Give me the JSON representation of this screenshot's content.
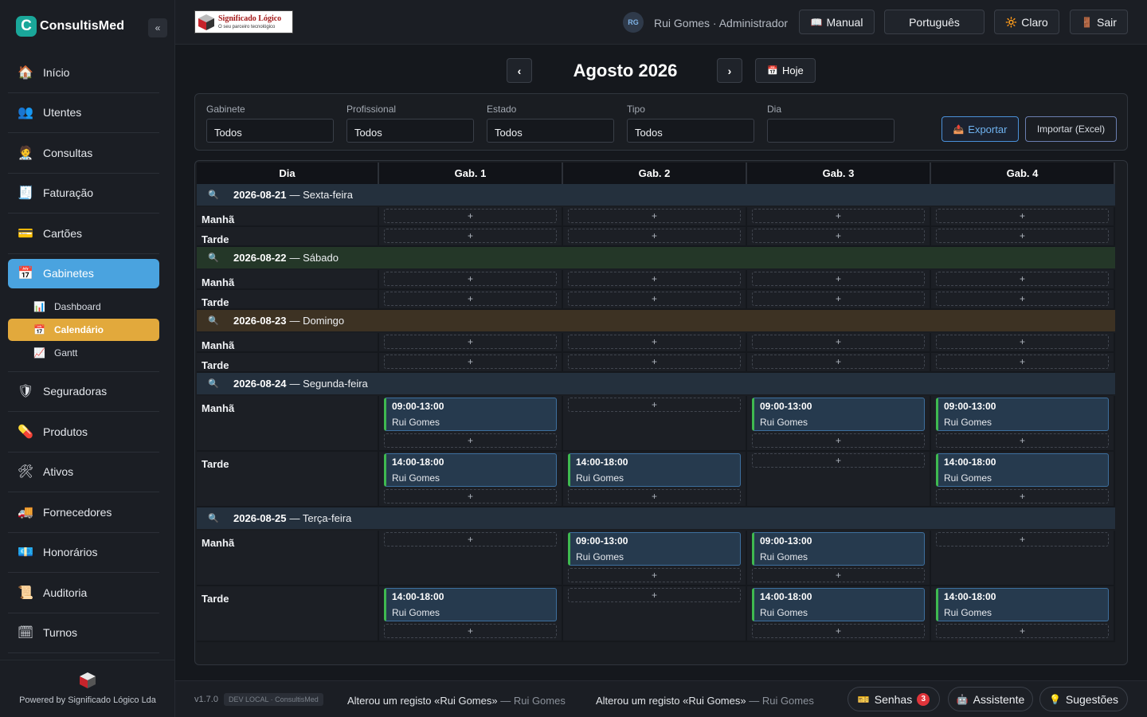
{
  "app": {
    "brand": "ConsultisMed",
    "brand_letter": "C",
    "collapse": "«",
    "powered_by": "Powered by Significado Lógico Lda"
  },
  "company_logo": {
    "title": "Significado Lógico",
    "tagline": "O seu parceiro tecnológico"
  },
  "sidebar": {
    "items": [
      {
        "label": "Início",
        "icon": "home-icon",
        "glyph": "🏠"
      },
      {
        "label": "Utentes",
        "icon": "users-icon",
        "glyph": "👥"
      },
      {
        "label": "Consultas",
        "icon": "doctor-icon",
        "glyph": "🧑‍⚕️"
      },
      {
        "label": "Faturação",
        "icon": "invoice-icon",
        "glyph": "🧾"
      },
      {
        "label": "Cartões",
        "icon": "card-icon",
        "glyph": "💳"
      },
      {
        "label": "Gabinetes",
        "icon": "calendar-icon",
        "glyph": "📅"
      },
      {
        "label": "Seguradoras",
        "icon": "insurance-icon",
        "glyph": "🛡"
      },
      {
        "label": "Produtos",
        "icon": "pill-icon",
        "glyph": "💊"
      },
      {
        "label": "Ativos",
        "icon": "tools-icon",
        "glyph": "🛠"
      },
      {
        "label": "Fornecedores",
        "icon": "truck-icon",
        "glyph": "🚚"
      },
      {
        "label": "Honorários",
        "icon": "money-icon",
        "glyph": "💶"
      },
      {
        "label": "Auditoria",
        "icon": "scroll-icon",
        "glyph": "📜"
      },
      {
        "label": "Turnos",
        "icon": "schedule-icon",
        "glyph": "🗓"
      }
    ],
    "sub_items": [
      {
        "label": "Dashboard",
        "icon": "bar-chart-icon",
        "glyph": "📊"
      },
      {
        "label": "Calendário",
        "icon": "calendar-icon",
        "glyph": "📅"
      },
      {
        "label": "Gantt",
        "icon": "line-chart-icon",
        "glyph": "📈"
      }
    ]
  },
  "topbar": {
    "avatar": "RG",
    "user": "Rui Gomes · Administrador",
    "manual": "Manual",
    "manual_glyph": "📖",
    "language": "Português",
    "theme": "Claro",
    "theme_glyph": "🔆",
    "logout": "Sair",
    "logout_glyph": "🚪"
  },
  "calendar": {
    "prev": "‹",
    "next": "›",
    "month": "Agosto 2026",
    "today": "Hoje",
    "today_glyph": "📅",
    "filters": [
      {
        "label": "Gabinete",
        "value": "Todos"
      },
      {
        "label": "Profissional",
        "value": "Todos"
      },
      {
        "label": "Estado",
        "value": "Todos"
      },
      {
        "label": "Tipo",
        "value": "Todos"
      },
      {
        "label": "Dia",
        "value": ""
      }
    ],
    "export": "Exportar",
    "export_glyph": "📤",
    "import": "Importar (Excel)",
    "columns": [
      "Dia",
      "Gab. 1",
      "Gab. 2",
      "Gab. 3",
      "Gab. 4"
    ],
    "plus": "+",
    "days": [
      {
        "date": "2026-08-21",
        "weekday": "— Sexta-feira",
        "tone": "blue",
        "slots": [
          {
            "label": "Manhã",
            "cells": [
              [],
              [],
              [],
              []
            ]
          },
          {
            "label": "Tarde",
            "cells": [
              [],
              [],
              [],
              []
            ]
          }
        ]
      },
      {
        "date": "2026-08-22",
        "weekday": "— Sábado",
        "tone": "green",
        "slots": [
          {
            "label": "Manhã",
            "cells": [
              [],
              [],
              [],
              []
            ]
          },
          {
            "label": "Tarde",
            "cells": [
              [],
              [],
              [],
              []
            ]
          }
        ]
      },
      {
        "date": "2026-08-23",
        "weekday": "— Domingo",
        "tone": "brown",
        "slots": [
          {
            "label": "Manhã",
            "cells": [
              [],
              [],
              [],
              []
            ]
          },
          {
            "label": "Tarde",
            "cells": [
              [],
              [],
              [],
              []
            ]
          }
        ]
      },
      {
        "date": "2026-08-24",
        "weekday": "— Segunda-feira",
        "tone": "blue",
        "slots": [
          {
            "label": "Manhã",
            "cells": [
              [
                {
                  "time": "09:00-13:00",
                  "name": "Rui Gomes"
                }
              ],
              [],
              [
                {
                  "time": "09:00-13:00",
                  "name": "Rui Gomes"
                }
              ],
              [
                {
                  "time": "09:00-13:00",
                  "name": "Rui Gomes"
                }
              ]
            ]
          },
          {
            "label": "Tarde",
            "cells": [
              [
                {
                  "time": "14:00-18:00",
                  "name": "Rui Gomes"
                }
              ],
              [
                {
                  "time": "14:00-18:00",
                  "name": "Rui Gomes"
                }
              ],
              [],
              [
                {
                  "time": "14:00-18:00",
                  "name": "Rui Gomes"
                }
              ]
            ]
          }
        ]
      },
      {
        "date": "2026-08-25",
        "weekday": "— Terça-feira",
        "tone": "blue",
        "slots": [
          {
            "label": "Manhã",
            "cells": [
              [],
              [
                {
                  "time": "09:00-13:00",
                  "name": "Rui Gomes"
                }
              ],
              [
                {
                  "time": "09:00-13:00",
                  "name": "Rui Gomes"
                }
              ],
              []
            ]
          },
          {
            "label": "Tarde",
            "cells": [
              [
                {
                  "time": "14:00-18:00",
                  "name": "Rui Gomes"
                }
              ],
              [],
              [
                {
                  "time": "14:00-18:00",
                  "name": "Rui Gomes"
                }
              ],
              [
                {
                  "time": "14:00-18:00",
                  "name": "Rui Gomes"
                }
              ]
            ]
          }
        ]
      }
    ]
  },
  "statusbar": {
    "version": "v1.7.0",
    "env": "DEV LOCAL · ConsultisMed",
    "logs": [
      {
        "text": "Alterou um registo «Rui Gomes»",
        "who": "— Rui Gomes"
      },
      {
        "text": "Alterou um registo «Rui Gomes»",
        "who": "— Rui Gomes"
      }
    ],
    "senhas": "Senhas",
    "senhas_glyph": "🎫",
    "senhas_count": "3",
    "assistente": "Assistente",
    "assistente_glyph": "🤖",
    "sugestoes": "Sugestões",
    "sugestoes_glyph": "💡"
  },
  "colors": {
    "accent": "#4aa3df",
    "active_sub": "#e2a93c",
    "booking_bar": "#3fb950"
  }
}
